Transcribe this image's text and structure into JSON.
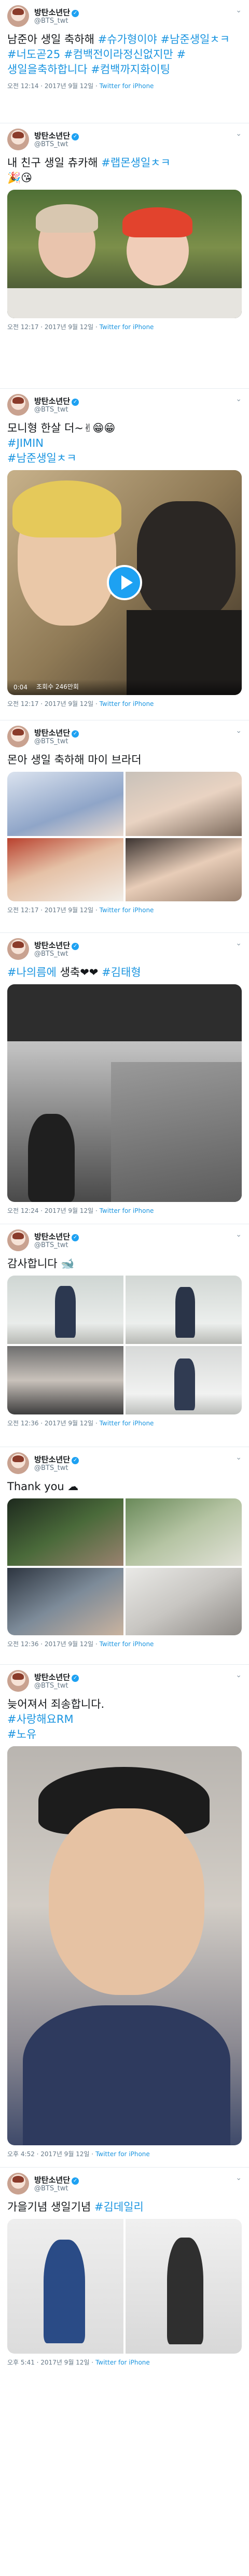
{
  "account": {
    "name": "방탄소년단",
    "handle": "@BTS_twt",
    "verified_mark": "✓",
    "chevron": "⌄"
  },
  "colors": {
    "link": "#1b95e0",
    "meta": "#657786",
    "verified": "#1da1f2"
  },
  "tweets": [
    {
      "parts": [
        {
          "t": "남준아 생일 축하해 "
        },
        {
          "t": "#슈가형이야",
          "tag": true
        },
        {
          "t": " "
        },
        {
          "t": "#남준생일ㅊㅋ",
          "tag": true
        },
        {
          "t": " "
        },
        {
          "t": "#너도곧25",
          "tag": true
        },
        {
          "t": " "
        },
        {
          "t": "#컴백전이라정신없지만",
          "tag": true
        },
        {
          "t": " "
        },
        {
          "t": "#생일을축하합니다",
          "tag": true
        },
        {
          "t": " "
        },
        {
          "t": "#컴백까지화이팅",
          "tag": true
        }
      ],
      "time": "오전 12:14 · 2017년 9월 12일",
      "source": "Twitter for iPhone"
    },
    {
      "parts": [
        {
          "t": "내 친구 생일 츄카해 "
        },
        {
          "t": "#랩몬생일ㅊㅋ",
          "tag": true
        },
        {
          "t": "\n🎉😘"
        }
      ],
      "time": "오전 12:17 · 2017년 9월 12일",
      "source": "Twitter for iPhone"
    },
    {
      "parts": [
        {
          "t": "모니형 한살 더~✌😁😁\n"
        },
        {
          "t": "#JIMIN",
          "tag": true
        },
        {
          "t": "\n"
        },
        {
          "t": "#남준생일ㅊㅋ",
          "tag": true
        }
      ],
      "video": {
        "duration": "0:04",
        "views": "조회수 246만회"
      },
      "time": "오전 12:17 · 2017년 9월 12일",
      "source": "Twitter for iPhone"
    },
    {
      "parts": [
        {
          "t": "몬아 생일 축하해 마이 브라더"
        }
      ],
      "time": "오전 12:17 · 2017년 9월 12일",
      "source": "Twitter for iPhone"
    },
    {
      "parts": [
        {
          "t": "#나의름에",
          "tag": true
        },
        {
          "t": " 생축❤❤ "
        },
        {
          "t": "#김태형",
          "tag": true
        }
      ],
      "time": "오전 12:24 · 2017년 9월 12일",
      "source": "Twitter for iPhone"
    },
    {
      "parts": [
        {
          "t": "감사합니다 🐋"
        }
      ],
      "time": "오전 12:36 · 2017년 9월 12일",
      "source": "Twitter for iPhone"
    },
    {
      "parts": [
        {
          "t": "Thank you ☁"
        }
      ],
      "time": "오전 12:36 · 2017년 9월 12일",
      "source": "Twitter for iPhone"
    },
    {
      "parts": [
        {
          "t": "늦어져서 죄송합니다.\n"
        },
        {
          "t": "#사랑해요RM",
          "tag": true
        },
        {
          "t": "\n"
        },
        {
          "t": "#노유",
          "tag": true
        }
      ],
      "time": "오후 4:52 · 2017년 9월 12일",
      "source": "Twitter for iPhone"
    },
    {
      "parts": [
        {
          "t": "가을기념 생일기념 "
        },
        {
          "t": "#김데일리",
          "tag": true
        }
      ],
      "time": "오후 5:41 · 2017년 9월 12일",
      "source": "Twitter for iPhone"
    }
  ]
}
